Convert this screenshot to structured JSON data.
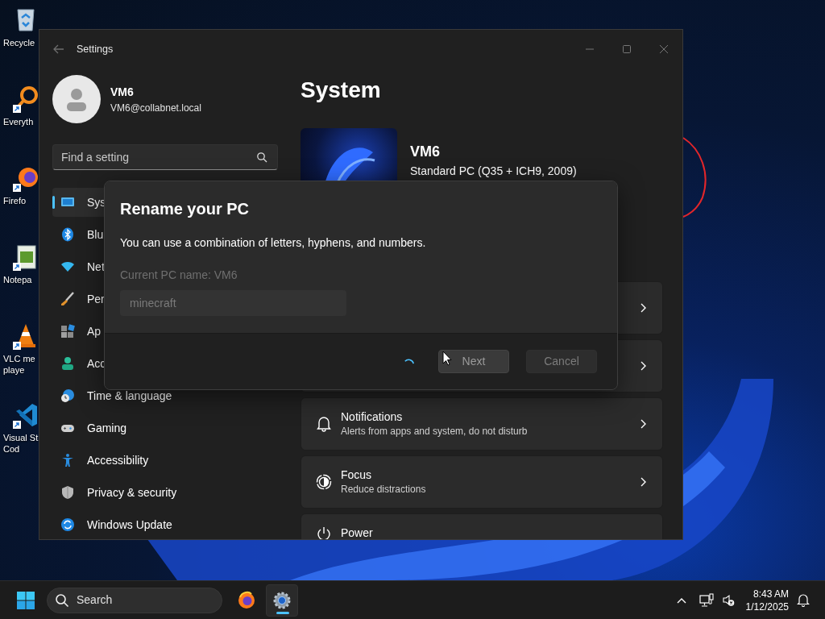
{
  "desktop_icons": [
    {
      "label_lines": [
        "Recycle"
      ],
      "shortcut": false
    },
    {
      "label_lines": [
        "Everyth"
      ],
      "shortcut": true
    },
    {
      "label_lines": [
        "Firefo"
      ],
      "shortcut": true
    },
    {
      "label_lines": [
        "Notepa"
      ],
      "shortcut": true
    },
    {
      "label_lines": [
        "VLC me",
        "playe"
      ],
      "shortcut": true
    },
    {
      "label_lines": [
        "Visual St",
        "Cod"
      ],
      "shortcut": true
    }
  ],
  "window": {
    "title": "Settings"
  },
  "account": {
    "name": "VM6",
    "email": "VM6@collabnet.local"
  },
  "search": {
    "placeholder": "Find a setting"
  },
  "nav": [
    {
      "label": "Sys",
      "selected": true
    },
    {
      "label": "Blu",
      "selected": false
    },
    {
      "label": "Net",
      "selected": false
    },
    {
      "label": "Per",
      "selected": false
    },
    {
      "label": "Ap",
      "selected": false
    },
    {
      "label": "Acc",
      "selected": false
    },
    {
      "label": "Time & language",
      "selected": false
    },
    {
      "label": "Gaming",
      "selected": false
    },
    {
      "label": "Accessibility",
      "selected": false
    },
    {
      "label": "Privacy & security",
      "selected": false
    },
    {
      "label": "Windows Update",
      "selected": false
    }
  ],
  "page": {
    "title": "System",
    "device_name": "VM6",
    "device_model": "Standard PC (Q35 + ICH9, 2009)"
  },
  "settings_rows": [
    {
      "kind": "covered"
    },
    {
      "kind": "covered"
    },
    {
      "kind": "item",
      "title": "Notifications",
      "subtitle": "Alerts from apps and system, do not disturb"
    },
    {
      "kind": "item",
      "title": "Focus",
      "subtitle": "Reduce distractions"
    },
    {
      "kind": "cut",
      "title": "Power"
    }
  ],
  "dialog": {
    "title": "Rename your PC",
    "description": "You can use a combination of letters, hyphens, and numbers.",
    "current_name_label": "Current PC name: VM6",
    "name_field": {
      "value": "minecraft",
      "disabled": true
    },
    "busy": true,
    "buttons": [
      {
        "label": "Next",
        "disabled": true,
        "hovered": true
      },
      {
        "label": "Cancel",
        "disabled": true,
        "hovered": false
      }
    ]
  },
  "taskbar": {
    "search_placeholder": "Search",
    "apps": [
      {
        "selected": false
      },
      {
        "selected": true
      }
    ],
    "time": "8:43 AM",
    "date": "1/12/2025"
  }
}
